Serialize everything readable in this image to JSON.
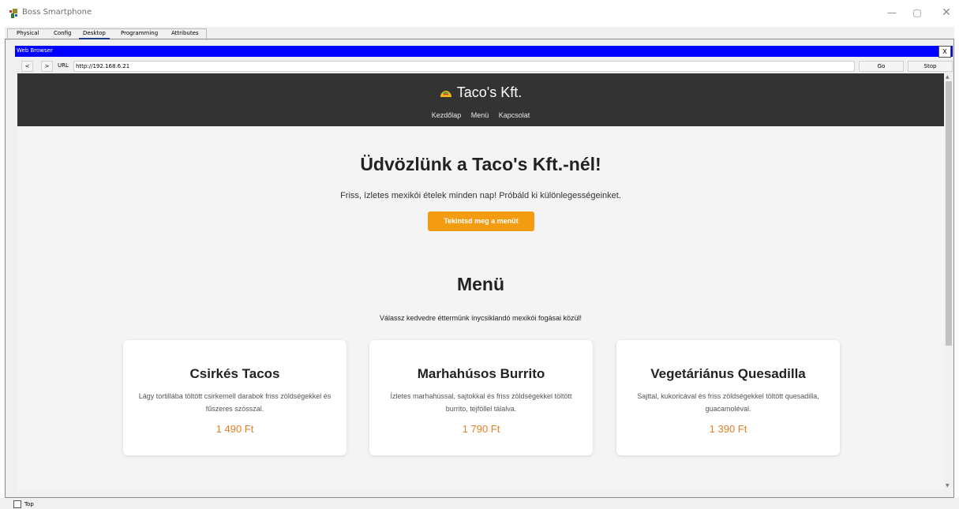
{
  "window": {
    "title": "Boss Smartphone",
    "minimize_glyph": "—",
    "maximize_glyph": "▢",
    "close_glyph": "✕"
  },
  "tabs": [
    "Physical",
    "Config",
    "Desktop",
    "Programming",
    "Attributes"
  ],
  "active_tab": "Desktop",
  "web_browser": {
    "title": "Web Browser",
    "close_label": "X",
    "back_label": "<",
    "forward_label": ">",
    "url_label": "URL",
    "url_value": "http://192.168.6.21",
    "go_label": "Go",
    "stop_label": "Stop"
  },
  "site": {
    "brand": "Taco's Kft.",
    "nav": [
      "Kezdőlap",
      "Menü",
      "Kapcsolat"
    ],
    "hero_title": "Üdvözlünk a Taco's Kft.-nél!",
    "hero_subtitle": "Friss, ízletes mexikói ételek minden nap! Próbáld ki különlegességeinket.",
    "cta_label": "Tekintsd meg a menüt",
    "menu_title": "Menü",
    "menu_subtitle": "Válassz kedvedre éttermünk ínycsiklandó mexikói fogásai közül!",
    "items": [
      {
        "name": "Csirkés Tacos",
        "description": "Lágy tortillába töltött csirkemell darabok friss zöldségekkel és fűszeres szósszal.",
        "price": "1 490 Ft"
      },
      {
        "name": "Marhahúsos Burrito",
        "description": "Ízletes marhahússal, sajtokkal és friss zöldségekkel töltött burrito, tejföllel tálalva.",
        "price": "1 790 Ft"
      },
      {
        "name": "Vegetáriánus Quesadilla",
        "description": "Sajttal, kukoricával és friss zöldségekkel töltött quesadilla, guacamoléval.",
        "price": "1 390 Ft"
      }
    ]
  },
  "statusbar": {
    "top_label": "Top"
  },
  "colors": {
    "header_bg": "#333333",
    "accent": "#f39c12",
    "price": "#e67e22",
    "browser_bar": "#0000ff"
  }
}
